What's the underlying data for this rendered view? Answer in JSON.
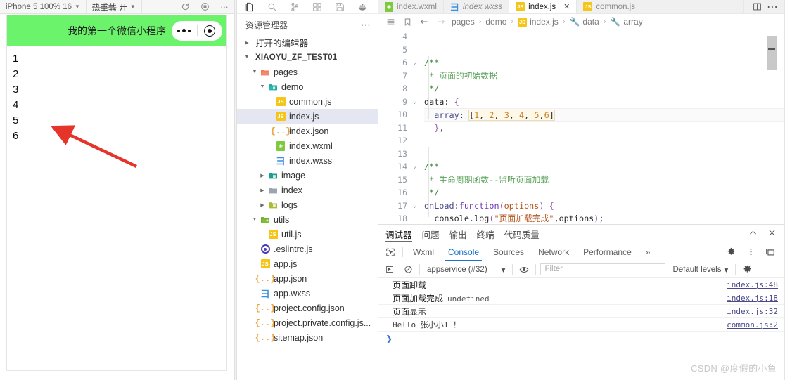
{
  "simulator": {
    "toolbar": {
      "device": "iPhone 5 100% 16",
      "hot_reload": "热重载",
      "compile_mode": "开",
      "refresh_icon": "refresh-icon",
      "record_icon": "record-icon",
      "more_icon": "more-icon"
    },
    "navbar": {
      "title": "我的第一个微信小程序",
      "capsule_more_icon": "capsule-more-icon",
      "capsule_target_icon": "capsule-target-icon"
    },
    "list": [
      "1",
      "2",
      "3",
      "4",
      "5",
      "6"
    ]
  },
  "activity_bar": {
    "icons": [
      "explorer-icon",
      "search-icon",
      "source-control-icon",
      "extensions-icon",
      "save-all-icon",
      "docker-icon"
    ]
  },
  "explorer": {
    "title": "资源管理器",
    "more_icon": "more-icon",
    "open_editors": "打开的编辑器",
    "project": "XIAOYU_ZF_TEST01",
    "tree": [
      {
        "label": "pages",
        "kind": "folder-open",
        "indent": 1,
        "expanded": true
      },
      {
        "label": "demo",
        "kind": "folder-open-teal",
        "indent": 2,
        "expanded": true
      },
      {
        "label": "common.js",
        "kind": "js",
        "indent": 3
      },
      {
        "label": "index.js",
        "kind": "js",
        "indent": 3,
        "selected": true
      },
      {
        "label": "index.json",
        "kind": "json",
        "indent": 3
      },
      {
        "label": "index.wxml",
        "kind": "wxml",
        "indent": 3
      },
      {
        "label": "index.wxss",
        "kind": "wxss",
        "indent": 3
      },
      {
        "label": "image",
        "kind": "folder-teal",
        "indent": 2,
        "expanded": false
      },
      {
        "label": "index",
        "kind": "folder-gray",
        "indent": 2,
        "expanded": false
      },
      {
        "label": "logs",
        "kind": "folder-olive",
        "indent": 2,
        "expanded": false
      },
      {
        "label": "utils",
        "kind": "folder-open-green",
        "indent": 1,
        "expanded": true
      },
      {
        "label": "util.js",
        "kind": "js",
        "indent": 2
      },
      {
        "label": ".eslintrc.js",
        "kind": "eslint",
        "indent": 1
      },
      {
        "label": "app.js",
        "kind": "js",
        "indent": 1
      },
      {
        "label": "app.json",
        "kind": "json",
        "indent": 1
      },
      {
        "label": "app.wxss",
        "kind": "wxss",
        "indent": 1
      },
      {
        "label": "project.config.json",
        "kind": "json",
        "indent": 1
      },
      {
        "label": "project.private.config.js...",
        "kind": "json",
        "indent": 1
      },
      {
        "label": "sitemap.json",
        "kind": "json",
        "indent": 1
      }
    ]
  },
  "editor": {
    "tabs": [
      {
        "label": "index.wxml",
        "kind": "wxml",
        "active": false,
        "preview": false,
        "closable": false
      },
      {
        "label": "index.wxss",
        "kind": "wxss",
        "active": false,
        "preview": true,
        "closable": false
      },
      {
        "label": "index.js",
        "kind": "js",
        "active": true,
        "preview": false,
        "closable": true,
        "close_label": "✕"
      },
      {
        "label": "common.js",
        "kind": "js",
        "active": false,
        "preview": false,
        "closable": false
      }
    ],
    "tab_actions": [
      "split-editor-icon",
      "more-actions-icon"
    ],
    "breadcrumb": {
      "outline_icon": "outline-icon",
      "bookmark_icon": "bookmark-icon",
      "back_icon": "arrow-left-icon",
      "forward_icon": "arrow-right-icon",
      "items": [
        "pages",
        "demo",
        "index.js",
        "data",
        "array"
      ],
      "separator": "›"
    },
    "code": {
      "first_line": 4,
      "lines": [
        {
          "n": 4,
          "fold": "",
          "text": ""
        },
        {
          "n": 5,
          "fold": "",
          "text": ""
        },
        {
          "n": 6,
          "fold": "v",
          "text": "/**"
        },
        {
          "n": 7,
          "fold": "",
          "text": " * 页面的初始数据"
        },
        {
          "n": 8,
          "fold": "",
          "text": " */"
        },
        {
          "n": 9,
          "fold": "v",
          "text": "data: {"
        },
        {
          "n": 10,
          "fold": "",
          "text": "  array: [1, 2, 3, 4, 5,6]"
        },
        {
          "n": 11,
          "fold": "",
          "text": "  },"
        },
        {
          "n": 12,
          "fold": "",
          "text": ""
        },
        {
          "n": 13,
          "fold": "",
          "text": ""
        },
        {
          "n": 14,
          "fold": "v",
          "text": "/**"
        },
        {
          "n": 15,
          "fold": "",
          "text": " * 生命周期函数--监听页面加载"
        },
        {
          "n": 16,
          "fold": "",
          "text": " */"
        },
        {
          "n": 17,
          "fold": "v",
          "text": "onLoad:function(options) {"
        },
        {
          "n": 18,
          "fold": "",
          "text": "  console.log(\"页面加载完成\",options);"
        }
      ],
      "array_values": [
        1,
        2,
        3,
        4,
        5,
        6
      ]
    }
  },
  "panel": {
    "tabs": [
      {
        "label": "调试器",
        "active": true
      },
      {
        "label": "问题",
        "active": false
      },
      {
        "label": "输出",
        "active": false
      },
      {
        "label": "终端",
        "active": false
      },
      {
        "label": "代码质量",
        "active": false
      }
    ],
    "collapse_icon": "chevron-up-icon",
    "close_icon": "close-icon",
    "devtools": {
      "inspect_icon": "inspect-element-icon",
      "tabs": [
        {
          "label": "Wxml",
          "active": false
        },
        {
          "label": "Console",
          "active": true
        },
        {
          "label": "Sources",
          "active": false
        },
        {
          "label": "Network",
          "active": false
        },
        {
          "label": "Performance",
          "active": false
        }
      ],
      "overflow": "»",
      "settings_icon": "gear-icon",
      "kebab_icon": "kebab-menu-icon",
      "dock_icon": "dock-side-icon"
    },
    "console_toolbar": {
      "execute_icon": "execute-icon",
      "clear_icon": "clear-console-icon",
      "context": "appservice (#32)",
      "context_caret": "▾",
      "eye_icon": "live-expression-icon",
      "filter_placeholder": "Filter",
      "levels": "Default levels",
      "levels_caret": "▾",
      "settings_icon": "gear-icon"
    },
    "console_rows": [
      {
        "msg": "页面卸载",
        "extra": "",
        "source": "index.js:48"
      },
      {
        "msg": "页面加载完成",
        "extra": "undefined",
        "source": "index.js:18"
      },
      {
        "msg": "页面显示",
        "extra": "",
        "source": "index.js:32"
      },
      {
        "msg": "Hello 张小小1 ！",
        "extra": "",
        "source": "common.js:2",
        "mono": true
      }
    ],
    "prompt": "❯"
  },
  "watermark": "CSDN @度假的小鱼",
  "colors": {
    "wechat_green": "#6cf36c",
    "selection": "#e4e6f1",
    "devtools_accent": "#1a73c8",
    "arrow_red": "#e5342a",
    "js_yellow": "#f5c518"
  }
}
